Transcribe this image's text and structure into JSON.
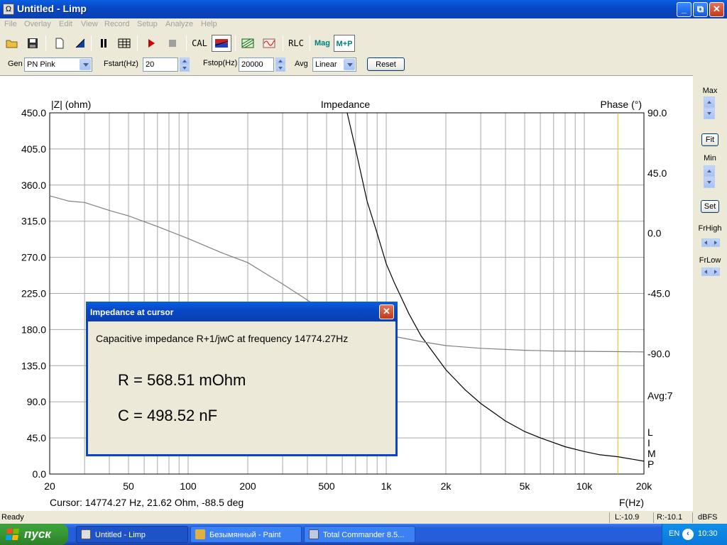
{
  "window": {
    "app_icon": "Ω",
    "title": "Untitled - Limp",
    "minimize": "_",
    "maximize": "⧉",
    "close": "✕"
  },
  "menu": [
    "File",
    "Overlay",
    "Edit",
    "View",
    "Record",
    "Setup",
    "Analyze",
    "Help"
  ],
  "toolbar": {
    "cal": "CAL",
    "rlc": "RLC",
    "mag": "Mag",
    "mp": "M+P"
  },
  "params": {
    "gen_label": "Gen",
    "gen_value": "PN Pink",
    "fstart_label": "Fstart(Hz)",
    "fstart_value": "20",
    "fstop_label": "Fstop(Hz)",
    "fstop_value": "20000",
    "avg_label": "Avg",
    "avg_value": "Linear",
    "reset": "Reset"
  },
  "chart_data": {
    "type": "line",
    "title": "Impedance",
    "ylabel_left": "|Z| (ohm)",
    "ylabel_right": "Phase (°)",
    "xlabel": "F(Hz)",
    "x_scale": "log",
    "xlim": [
      20,
      20000
    ],
    "ylim_left": [
      0,
      450
    ],
    "ylim_right": [
      -180,
      90
    ],
    "left_ticks": [
      "0.0",
      "45.0",
      "90.0",
      "135.0",
      "180.0",
      "225.0",
      "270.0",
      "315.0",
      "360.0",
      "405.0",
      "450.0"
    ],
    "right_ticks": [
      {
        "label": "90.0",
        "value": 90
      },
      {
        "label": "45.0",
        "value": 45
      },
      {
        "label": "0.0",
        "value": 0
      },
      {
        "label": "-45.0",
        "value": -45
      },
      {
        "label": "-90.0",
        "value": -90
      }
    ],
    "x_ticks": [
      {
        "label": "20",
        "value": 20
      },
      {
        "label": "50",
        "value": 50
      },
      {
        "label": "100",
        "value": 100
      },
      {
        "label": "200",
        "value": 200
      },
      {
        "label": "500",
        "value": 500
      },
      {
        "label": "1k",
        "value": 1000
      },
      {
        "label": "2k",
        "value": 2000
      },
      {
        "label": "5k",
        "value": 5000
      },
      {
        "label": "10k",
        "value": 10000
      },
      {
        "label": "20k",
        "value": 20000
      }
    ],
    "grid": true,
    "cursor_freq": 14774.27,
    "avg_label": "Avg:7",
    "watermark": [
      "L",
      "I",
      "M",
      "P"
    ],
    "cursor_readout": "Cursor: 14774.27 Hz, 21.62 Ohm, -88.5 deg",
    "series": [
      {
        "name": "|Z|",
        "axis": "left",
        "color": "#000000",
        "x": [
          635,
          700,
          800,
          900,
          1000,
          1100,
          1300,
          1500,
          2000,
          2500,
          3000,
          4000,
          5000,
          6000,
          8000,
          10000,
          12000,
          14774,
          20000
        ],
        "y": [
          450,
          405,
          340,
          300,
          262,
          238,
          200,
          172,
          130,
          105,
          88,
          66,
          53,
          45,
          34,
          28,
          24,
          21.6,
          16
        ]
      },
      {
        "name": "Phase",
        "axis": "right",
        "color": "#808080",
        "x": [
          20,
          25,
          30,
          40,
          50,
          70,
          100,
          150,
          200,
          300,
          400,
          500,
          700,
          1000,
          1500,
          2000,
          3000,
          5000,
          7000,
          10000,
          14774,
          20000
        ],
        "y": [
          28,
          24,
          23,
          17,
          13,
          5,
          -4,
          -15,
          -22,
          -38,
          -50,
          -60,
          -69,
          -76,
          -81,
          -84,
          -86,
          -87.5,
          -88,
          -88.3,
          -88.5,
          -88.7
        ]
      }
    ]
  },
  "rightpanel": {
    "max": "Max",
    "fit": "Fit",
    "min": "Min",
    "set": "Set",
    "frhigh": "FrHigh",
    "frlow": "FrLow"
  },
  "dialog": {
    "title": "Impedance at cursor",
    "message": "Capacitive impedance R+1/jwC at frequency 14774.27Hz",
    "r_value": "R = 568.51 mOhm",
    "c_value": "C = 498.52 nF"
  },
  "statusbar": {
    "ready": "Ready",
    "left": "L:-10.9",
    "right": "R:-10.1",
    "unit": "dBFS"
  },
  "taskbar": {
    "start": "пуск",
    "tasks": [
      {
        "label": "Untitled - Limp",
        "active": true
      },
      {
        "label": "Безымянный - Paint",
        "active": false
      },
      {
        "label": "Total Commander 8.5...",
        "active": false
      }
    ],
    "lang": "EN",
    "time": "10:30"
  }
}
